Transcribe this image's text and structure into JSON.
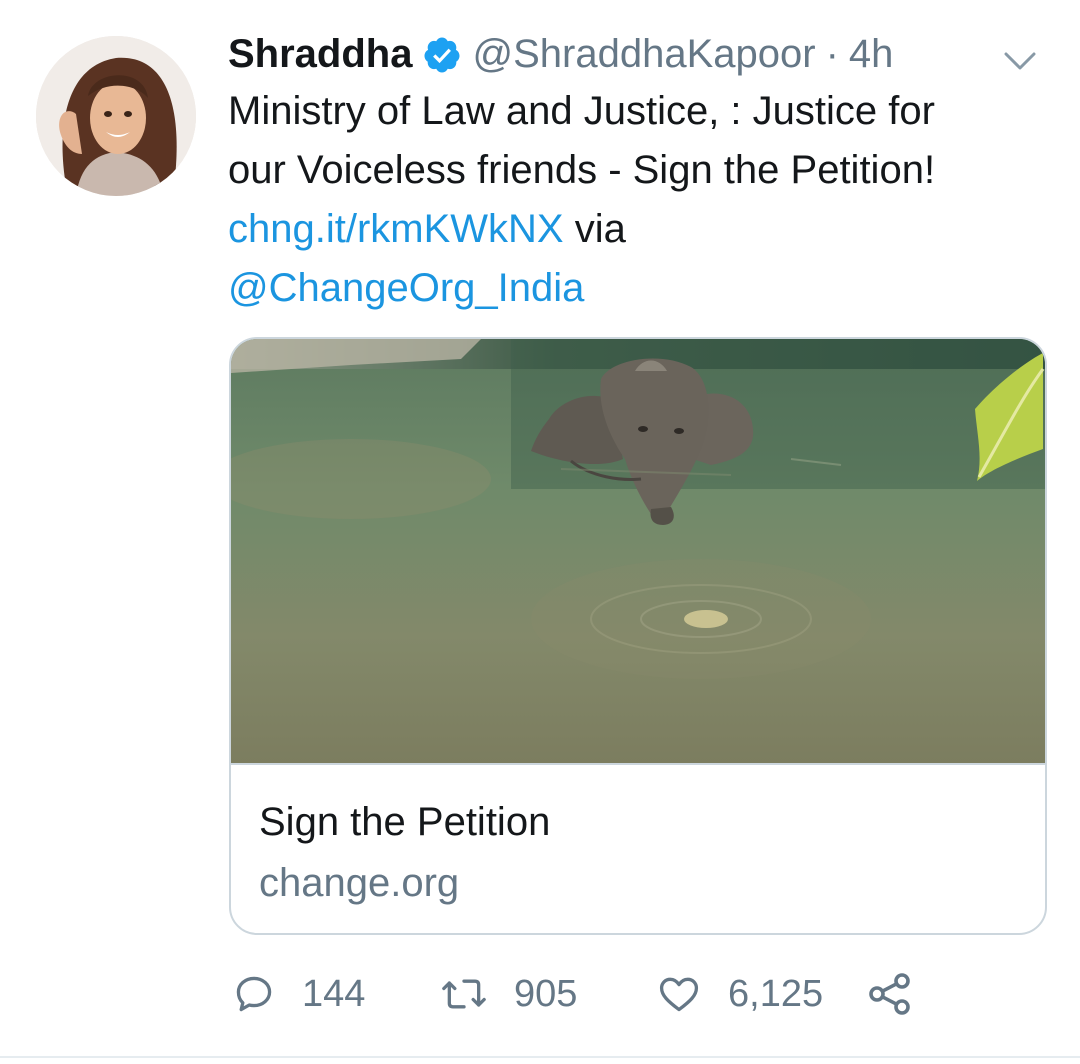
{
  "tweet": {
    "display_name": "Shraddha",
    "handle": "@ShraddhaKapoor",
    "separator": "·",
    "time": "4h",
    "text_line1": "Ministry of Law and Justice, : Justice for",
    "text_line2": "our Voiceless friends - Sign the Petition!",
    "link": "chng.it/rkmKWkNX",
    "via": " via",
    "mention": "@ChangeOrg_India"
  },
  "card": {
    "title": "Sign the Petition",
    "domain": "change.org"
  },
  "actions": {
    "replies": "144",
    "retweets": "905",
    "likes": "6,125"
  },
  "colors": {
    "link": "#1b95e0",
    "secondary_text": "#657786",
    "verified_badge": "#1da1f2",
    "border": "#ccd6dd"
  },
  "icons": [
    "verified-badge-icon",
    "chevron-down-icon",
    "reply-icon",
    "retweet-icon",
    "like-icon",
    "share-icon"
  ]
}
